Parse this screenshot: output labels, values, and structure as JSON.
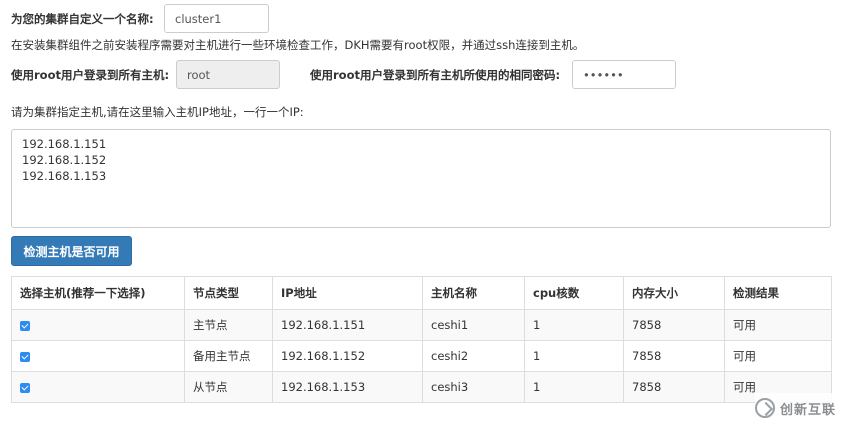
{
  "cluster": {
    "name_label": "为您的集群自定义一个名称:",
    "name_value": "cluster1"
  },
  "notice": "在安装集群组件之前安装程序需要对主机进行一些环境检查工作，DKH需要有root权限，并通过ssh连接到主机。",
  "root_user": {
    "label": "使用root用户登录到所有主机:",
    "value": "root"
  },
  "root_password": {
    "label": "使用root用户登录到所有主机所使用的相同密码:",
    "value": "••••••"
  },
  "hosts": {
    "label": "请为集群指定主机,请在这里输入主机IP地址，一行一个IP:",
    "lines": [
      "192.168.1.151",
      "192.168.1.152",
      "192.168.1.153"
    ]
  },
  "check_button": "检测主机是否可用",
  "table": {
    "headers": [
      "选择主机(推荐一下选择)",
      "节点类型",
      "IP地址",
      "主机名称",
      "cpu核数",
      "内存大小",
      "检测结果"
    ],
    "rows": [
      {
        "checked": true,
        "type": "主节点",
        "ip": "192.168.1.151",
        "hostname": "ceshi1",
        "cpu": "1",
        "mem": "7858",
        "result": "可用"
      },
      {
        "checked": true,
        "type": "备用主节点",
        "ip": "192.168.1.152",
        "hostname": "ceshi2",
        "cpu": "1",
        "mem": "7858",
        "result": "可用"
      },
      {
        "checked": true,
        "type": "从节点",
        "ip": "192.168.1.153",
        "hostname": "ceshi3",
        "cpu": "1",
        "mem": "7858",
        "result": "可用"
      }
    ]
  },
  "watermark": "创新互联",
  "colors": {
    "primary": "#337ab7",
    "checkbox": "#2d8cf0"
  }
}
